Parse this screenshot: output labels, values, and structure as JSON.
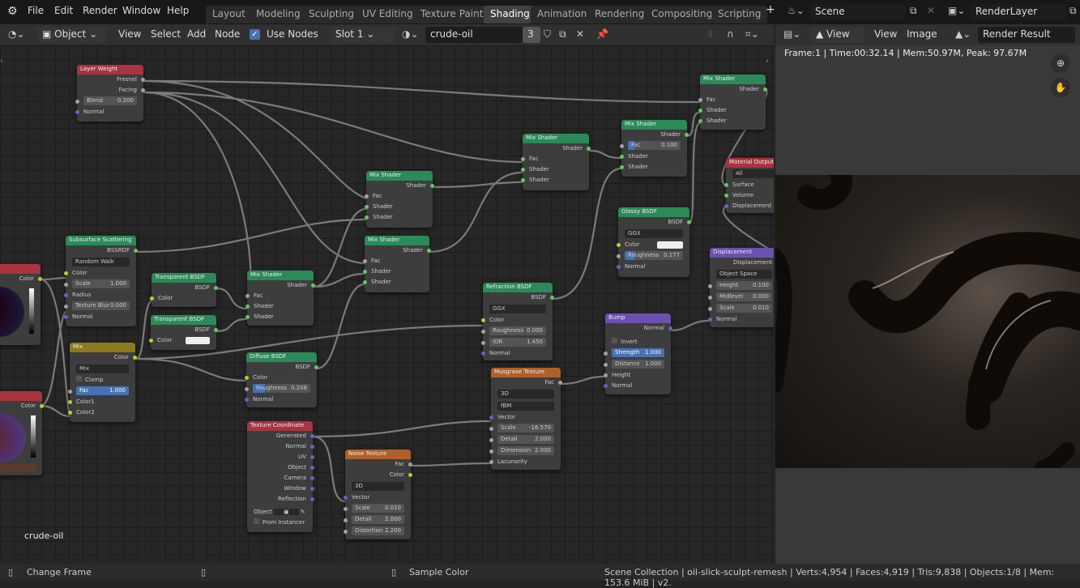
{
  "app": {
    "logo": "blender-logo-icon"
  },
  "menu": [
    "File",
    "Edit",
    "Render",
    "Window",
    "Help"
  ],
  "workspaces": [
    "Layout",
    "Modeling",
    "Sculpting",
    "UV Editing",
    "Texture Paint",
    "Shading",
    "Animation",
    "Rendering",
    "Compositing",
    "Scripting"
  ],
  "active_workspace": "Shading",
  "add_workspace": "+",
  "scene": {
    "name": "Scene",
    "view_layer": "RenderLayer"
  },
  "node_header": {
    "mode": "Object",
    "menus": [
      "View",
      "Select",
      "Add",
      "Node"
    ],
    "use_nodes_label": "Use Nodes",
    "use_nodes": true,
    "slot": "Slot 1",
    "material": "crude-oil",
    "users": "3"
  },
  "image_header": {
    "view_dd": "View",
    "menus": [
      "View",
      "Image"
    ],
    "image": "Render Result"
  },
  "render_info": "Frame:1 | Time:00:32.14 | Mem:50.97M, Peak: 97.67M",
  "editor_label": "crude-oil",
  "nodes": {
    "layer_weight": {
      "title": "Layer Weight",
      "out1": "Fresnel",
      "out2": "Facing",
      "blend_label": "Blend",
      "blend": "0.200",
      "normal": "Normal"
    },
    "sss": {
      "title": "Subsurface Scattering",
      "out": "BSSRDF",
      "method": "Random Walk",
      "color": "Color",
      "scale_label": "Scale",
      "scale": "1.000",
      "radius": "Radius",
      "blur_label": "Texture Blur",
      "blur": "0.000",
      "normal": "Normal"
    },
    "transparent1": {
      "title": "Transparent BSDF",
      "out": "BSDF",
      "color": "Color"
    },
    "transparent2": {
      "title": "Transparent BSDF",
      "out": "BSDF",
      "color": "Color"
    },
    "mix": {
      "title": "Mix",
      "out": "Color",
      "mode": "Mix",
      "clamp": "Clamp",
      "fac_label": "Fac",
      "fac": "1.000",
      "c1": "Color1",
      "c2": "Color2"
    },
    "rgb_top": {
      "out": "Color"
    },
    "rgb_bottom": {
      "out": "Color"
    },
    "mix_shader_a": {
      "title": "Mix Shader",
      "out": "Shader",
      "fac": "Fac",
      "s1": "Shader",
      "s2": "Shader"
    },
    "mix_shader_b": {
      "title": "Mix Shader",
      "out": "Shader",
      "fac": "Fac",
      "s1": "Shader",
      "s2": "Shader"
    },
    "mix_shader_c": {
      "title": "Mix Shader",
      "out": "Shader",
      "fac": "Fac",
      "s1": "Shader",
      "s2": "Shader"
    },
    "mix_shader_d": {
      "title": "Mix Shader",
      "out": "Shader",
      "fac": "Fac",
      "s1": "Shader",
      "s2": "Shader"
    },
    "mix_shader_e": {
      "title": "Mix Shader",
      "out": "Shader",
      "fac_label": "Fac",
      "fac": "0.100",
      "s1": "Shader",
      "s2": "Shader"
    },
    "mix_shader_f": {
      "title": "Mix Shader",
      "out": "Shader",
      "fac": "Fac",
      "s1": "Shader",
      "s2": "Shader"
    },
    "diffuse": {
      "title": "Diffuse BSDF",
      "out": "BSDF",
      "color": "Color",
      "rough_label": "Roughness",
      "rough": "0.208",
      "normal": "Normal"
    },
    "refraction": {
      "title": "Refraction BSDF",
      "out": "BSDF",
      "dist": "GGX",
      "color": "Color",
      "rough_label": "Roughness",
      "rough": "0.000",
      "ior_label": "IOR",
      "ior": "1.450",
      "normal": "Normal"
    },
    "glossy": {
      "title": "Glossy BSDF",
      "out": "BSDF",
      "dist": "GGX",
      "color": "Color",
      "rough_label": "Roughness",
      "rough": "0.177",
      "normal": "Normal"
    },
    "output": {
      "title": "Material Output",
      "target": "All",
      "surface": "Surface",
      "volume": "Volume",
      "disp": "Displacement"
    },
    "displacement": {
      "title": "Displacement",
      "out": "Displacement",
      "space": "Object Space",
      "h_label": "Height",
      "h": "0.100",
      "m_label": "Midlevel",
      "m": "0.000",
      "s_label": "Scale",
      "s": "0.010",
      "normal": "Normal"
    },
    "bump": {
      "title": "Bump",
      "out": "Normal",
      "invert": "Invert",
      "str_label": "Strength",
      "str": "1.000",
      "dist_label": "Distance",
      "dist": "1.000",
      "height": "Height",
      "normal": "Normal"
    },
    "musgrave": {
      "title": "Musgrave Texture",
      "out": "Fac",
      "dim": "3D",
      "type": "fBM",
      "vector": "Vector",
      "scale_label": "Scale",
      "scale": "-16.570",
      "detail_label": "Detail",
      "detail": "2.000",
      "dimension_label": "Dimension",
      "dimension": "2.000",
      "lac": "Lacunarity"
    },
    "texcoord": {
      "title": "Texture Coordinate",
      "outs": [
        "Generated",
        "Normal",
        "UV",
        "Object",
        "Camera",
        "Window",
        "Reflection"
      ],
      "object_label": "Object",
      "from_instancer": "From Instancer"
    },
    "noise": {
      "title": "Noise Texture",
      "out1": "Fac",
      "out2": "Color",
      "dim": "3D",
      "vector": "Vector",
      "scale_label": "Scale",
      "scale": "0.010",
      "detail_label": "Detail",
      "detail": "2.000",
      "dist_label": "Distortion",
      "dist": "2.200"
    }
  },
  "statusbar": {
    "left": "Change Frame",
    "right": "Sample Color",
    "stats": "Scene Collection | oil-slick-sculpt-remesh | Verts:4,954 | Faces:4,919 | Tris:9,838 | Objects:1/8 | Mem: 153.6 MiB | v2."
  }
}
